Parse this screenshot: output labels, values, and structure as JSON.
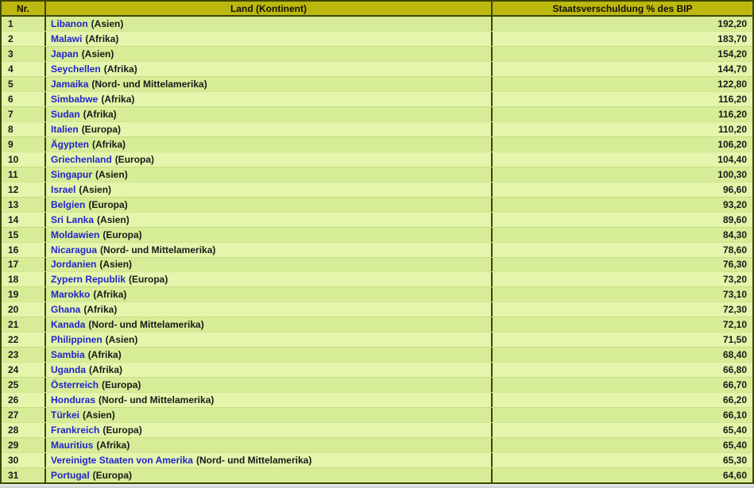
{
  "colors": {
    "header_bg": "#bcb80f",
    "border_dark": "#3d4506",
    "row_odd": "#d6ec96",
    "row_even": "#e3f6ab",
    "link_blue": "#2424cb",
    "text_dark": "#1a1a1a",
    "window_gray": "#d4d4cf"
  },
  "table": {
    "columns": [
      "Nr.",
      "Land (Kontinent)",
      "Staatsverschuldung % des BIP"
    ],
    "rows": [
      {
        "nr": "1",
        "country": "Libanon",
        "continent": "(Asien)",
        "value": "192,20"
      },
      {
        "nr": "2",
        "country": "Malawi",
        "continent": "(Afrika)",
        "value": "183,70"
      },
      {
        "nr": "3",
        "country": "Japan",
        "continent": "(Asien)",
        "value": "154,20"
      },
      {
        "nr": "4",
        "country": "Seychellen",
        "continent": "(Afrika)",
        "value": "144,70"
      },
      {
        "nr": "5",
        "country": "Jamaika",
        "continent": "(Nord- und Mittelamerika)",
        "value": "122,80"
      },
      {
        "nr": "6",
        "country": "Simbabwe",
        "continent": "(Afrika)",
        "value": "116,20"
      },
      {
        "nr": "7",
        "country": "Sudan",
        "continent": "(Afrika)",
        "value": "116,20"
      },
      {
        "nr": "8",
        "country": "Italien",
        "continent": "(Europa)",
        "value": "110,20"
      },
      {
        "nr": "9",
        "country": "Ägypten",
        "continent": "(Afrika)",
        "value": "106,20"
      },
      {
        "nr": "10",
        "country": "Griechenland",
        "continent": "(Europa)",
        "value": "104,40"
      },
      {
        "nr": "11",
        "country": "Singapur",
        "continent": "(Asien)",
        "value": "100,30"
      },
      {
        "nr": "12",
        "country": "Israel",
        "continent": "(Asien)",
        "value": "96,60"
      },
      {
        "nr": "13",
        "country": "Belgien",
        "continent": "(Europa)",
        "value": "93,20"
      },
      {
        "nr": "14",
        "country": "Sri Lanka",
        "continent": "(Asien)",
        "value": "89,60"
      },
      {
        "nr": "15",
        "country": "Moldawien",
        "continent": "(Europa)",
        "value": "84,30"
      },
      {
        "nr": "16",
        "country": "Nicaragua",
        "continent": "(Nord- und Mittelamerika)",
        "value": "78,60"
      },
      {
        "nr": "17",
        "country": "Jordanien",
        "continent": "(Asien)",
        "value": "76,30"
      },
      {
        "nr": "18",
        "country": "Zypern Republik",
        "continent": "(Europa)",
        "value": "73,20"
      },
      {
        "nr": "19",
        "country": "Marokko",
        "continent": "(Afrika)",
        "value": "73,10"
      },
      {
        "nr": "20",
        "country": "Ghana",
        "continent": "(Afrika)",
        "value": "72,30"
      },
      {
        "nr": "21",
        "country": "Kanada",
        "continent": "(Nord- und Mittelamerika)",
        "value": "72,10"
      },
      {
        "nr": "22",
        "country": "Philippinen",
        "continent": "(Asien)",
        "value": "71,50"
      },
      {
        "nr": "23",
        "country": "Sambia",
        "continent": "(Afrika)",
        "value": "68,40"
      },
      {
        "nr": "24",
        "country": "Uganda",
        "continent": "(Afrika)",
        "value": "66,80"
      },
      {
        "nr": "25",
        "country": "Österreich",
        "continent": "(Europa)",
        "value": "66,70"
      },
      {
        "nr": "26",
        "country": "Honduras",
        "continent": "(Nord- und Mittelamerika)",
        "value": "66,20"
      },
      {
        "nr": "27",
        "country": "Türkei",
        "continent": "(Asien)",
        "value": "66,10"
      },
      {
        "nr": "28",
        "country": "Frankreich",
        "continent": "(Europa)",
        "value": "65,40"
      },
      {
        "nr": "29",
        "country": "Mauritius",
        "continent": "(Afrika)",
        "value": "65,40"
      },
      {
        "nr": "30",
        "country": "Vereinigte Staaten von Amerika",
        "continent": "(Nord- und Mittelamerika)",
        "value": "65,30"
      },
      {
        "nr": "31",
        "country": "Portugal",
        "continent": "(Europa)",
        "value": "64,60"
      }
    ]
  }
}
